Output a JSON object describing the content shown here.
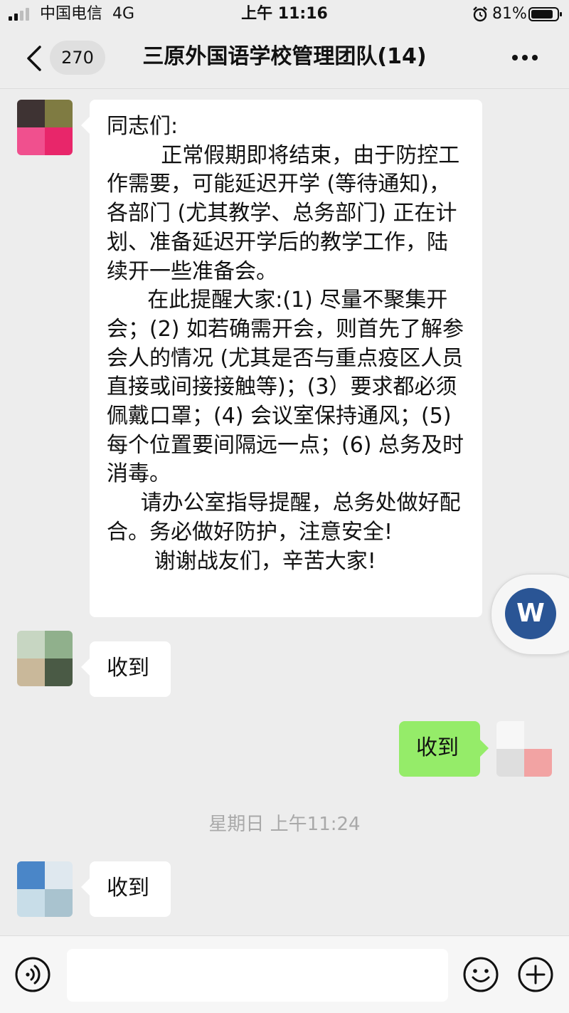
{
  "status_bar": {
    "carrier": "中国电信",
    "network": "4G",
    "time": "上午 11:16",
    "battery": "81%"
  },
  "header": {
    "unread_count": "270",
    "title": "三原外国语学校管理团队(14)"
  },
  "messages": [
    {
      "side": "left",
      "text": "同志们:\n        正常假期即将结束，由于防控工作需要，可能延迟开学 (等待通知)，各部门 (尤其教学、总务部门) 正在计划、准备延迟开学后的教学工作，陆续开一些准备会。\n      在此提醒大家:(1) 尽量不聚集开会；(2) 如若确需开会，则首先了解参会人的情况 (尤其是否与重点疫区人员直接或间接接触等)；(3）要求都必须佩戴口罩；(4) 会议室保持通风；(5) 每个位置要间隔远一点；(6) 总务及时消毒。\n     请办公室指导提醒，总务处做好配合。务必做好防护，注意安全!\n       谢谢战友们，辛苦大家!"
    },
    {
      "side": "left",
      "text": "收到"
    },
    {
      "side": "right",
      "text": "收到"
    },
    {
      "side": "left",
      "text": "收到"
    }
  ],
  "time_divider": "星期日 上午11:24",
  "floating_button": {
    "label": "W",
    "color": "#2a5595"
  },
  "input_bar": {
    "placeholder": ""
  },
  "colors": {
    "background": "#ededed",
    "bubble_self": "#95ec69",
    "bubble_other": "#ffffff"
  }
}
